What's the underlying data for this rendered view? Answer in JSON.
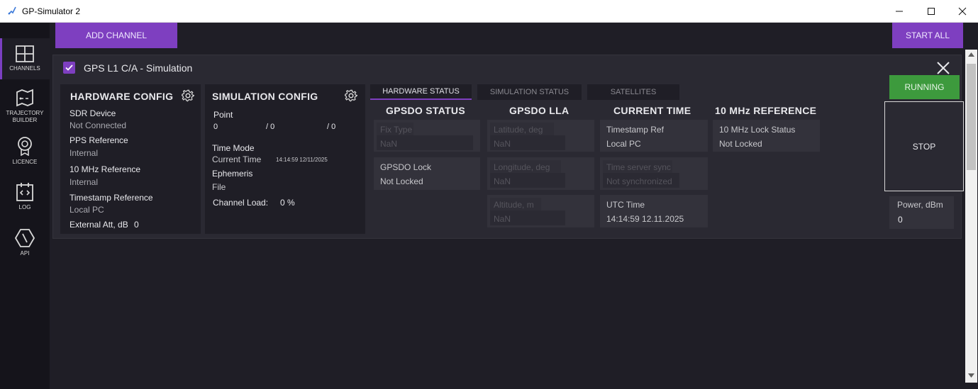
{
  "window": {
    "title": "GP-Simulator 2"
  },
  "sidebar": {
    "items": [
      {
        "label": "CHANNELS",
        "icon": "channels-icon"
      },
      {
        "label": "TRAJECTORY BUILDER",
        "icon": "trajectory-icon"
      },
      {
        "label": "LICENCE",
        "icon": "licence-icon"
      },
      {
        "label": "LOG",
        "icon": "log-icon"
      },
      {
        "label": "API",
        "icon": "api-icon"
      }
    ]
  },
  "toolbar": {
    "add_channel": "ADD CHANNEL",
    "start_all": "START ALL"
  },
  "channel": {
    "title": "GPS L1 C/A - Simulation",
    "checked": true,
    "hardware_config": {
      "title": "HARDWARE CONFIG",
      "sdr_device_label": "SDR Device",
      "sdr_device_value": "Not Connected",
      "pps_label": "PPS Reference",
      "pps_value": "Internal",
      "mhz_label": "10 MHz Reference",
      "mhz_value": "Internal",
      "timestamp_label": "Timestamp Reference",
      "timestamp_value": "Local PC",
      "att_label": "External Att, dB",
      "att_value": "0"
    },
    "simulation_config": {
      "title": "SIMULATION CONFIG",
      "point_label": "Point",
      "point_values": [
        "0",
        "/ 0",
        "/ 0"
      ],
      "time_mode_label": "Time Mode",
      "time_mode_value": "Current Time",
      "time_mode_time": "14:14:59  12/11/2025",
      "ephemeris_label": "Ephemeris",
      "ephemeris_value": "File",
      "load_label": "Channel Load:",
      "load_value": "0 %"
    },
    "tabs": [
      "HARDWARE STATUS",
      "SIMULATION STATUS",
      "SATELLITES"
    ],
    "status": {
      "gpsdo_status": {
        "title": "GPSDO STATUS",
        "fix_type_label": "Fix Type",
        "fix_type_value": "NaN",
        "lock_label": "GPSDO Lock",
        "lock_value": "Not Locked"
      },
      "gpsdo_lla": {
        "title": "GPSDO LLA",
        "lat_label": "Latitude, deg",
        "lat_value": "NaN",
        "lon_label": "Longitude, deg",
        "lon_value": "NaN",
        "alt_label": "Altitude, m",
        "alt_value": "NaN"
      },
      "current_time": {
        "title": "CURRENT TIME",
        "ts_ref_label": "Timestamp Ref",
        "ts_ref_value": "Local PC",
        "sync_label": "Time server sync",
        "sync_value": "Not synchronized",
        "utc_label": "UTC Time",
        "utc_value": "14:14:59 12.11.2025"
      },
      "ref_10mhz": {
        "title": "10 MHz REFERENCE",
        "lock_label": "10 MHz Lock Status",
        "lock_value": "Not Locked"
      }
    },
    "running_label": "RUNNING",
    "stop_label": "STOP",
    "power_label": "Power, dBm",
    "power_value": "0"
  },
  "colors": {
    "accent": "#7e3fc0",
    "running": "#3d9a3d",
    "background": "#1f1e26"
  }
}
